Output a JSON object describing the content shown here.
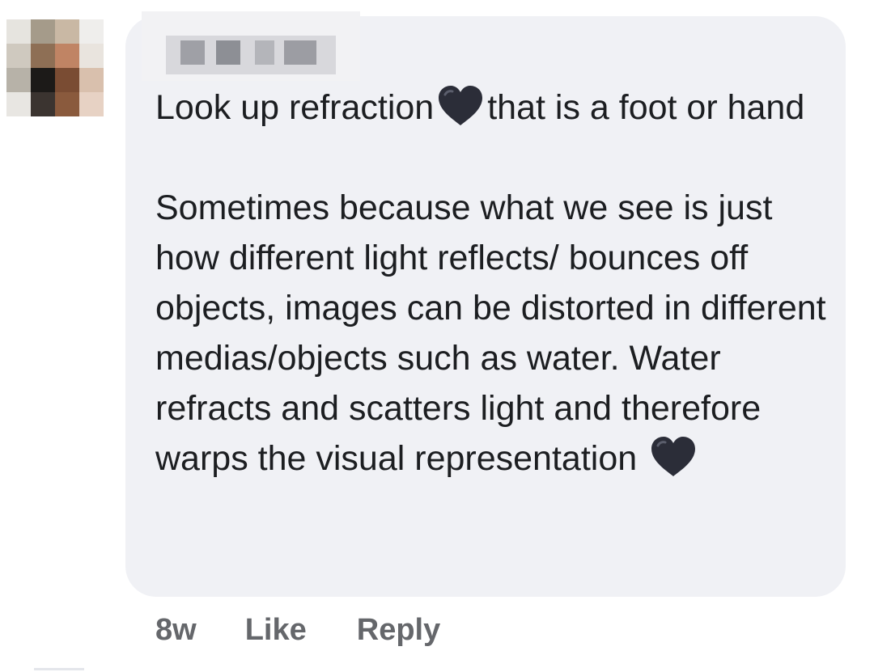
{
  "comment": {
    "author_name": "",
    "paragraph_1": {
      "before_heart": "Look up refraction",
      "heart_icon": "black-heart-emoji",
      "after_heart": "that is a foot or hand"
    },
    "paragraph_2": {
      "text": "Sometimes because what we see is just how different light reflects/ bounces off objects, images can be distorted in different medias/objects such as water. Water refracts and scatters light and therefore warps the visual representation",
      "heart_icon": "black-heart-emoji"
    }
  },
  "actions": {
    "timestamp": "8w",
    "like_label": "Like",
    "reply_label": "Reply"
  },
  "colors": {
    "bubble_background": "#f0f1f5",
    "text": "#1c1e21",
    "action_text": "#65676b",
    "heart": "#2b2d38"
  }
}
